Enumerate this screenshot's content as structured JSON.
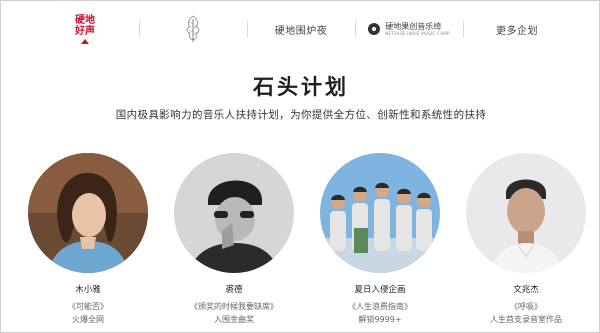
{
  "nav": {
    "logo_left_text": "硬地",
    "logo_left_text2": "好声",
    "item_brand2_icon": "tree-brush-icon",
    "item_3_label": "硬地围炉夜",
    "brand4_cn": "硬地果创音乐绮",
    "brand4_en": "NETEASE INDIE MUSIC CAMP",
    "item_5_label": "更多企划"
  },
  "header": {
    "title": "石头计划",
    "subtitle": "国内极具影响力的音乐人扶持计划，为你提供全方位、创新性和系统性的扶持"
  },
  "cards": [
    {
      "name": "木小雅",
      "work": "《可能否》",
      "desc": "火爆全网"
    },
    {
      "name": "裘德",
      "work": "《颁奖的时候我要缺席》",
      "desc": "入围金曲奖"
    },
    {
      "name": "夏日入侵企画",
      "work": "《人生浪费指南》",
      "desc": "解锁9999+"
    },
    {
      "name": "文兆杰",
      "work": "《呼吸》",
      "desc": "人生首支录音室作品"
    }
  ],
  "colors": {
    "accent_red": "#c8102e",
    "sky_blue": "#7fb4e0"
  }
}
